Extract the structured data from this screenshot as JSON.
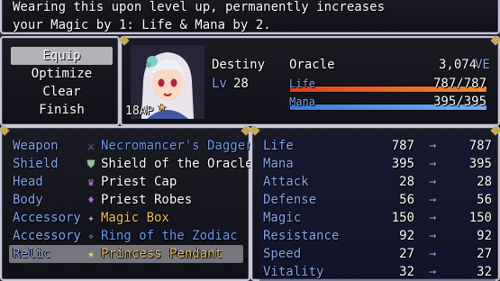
{
  "help": {
    "line1": "Wearing this upon level up, permanently increases",
    "line2": "your Magic by 1: Life & Mana by 2."
  },
  "commands": [
    "Equip",
    "Optimize",
    "Clear",
    "Finish"
  ],
  "actor": {
    "name": "Destiny",
    "class": "Oracle",
    "level_label": "Lv",
    "level": "28",
    "ap_badge": "18AP",
    "currency": "3,074",
    "currency_unit": "VE",
    "life_label": "Life",
    "life_value": "787/787",
    "life_ratio": 1.0,
    "mana_label": "Mana",
    "mana_value": "395/395",
    "mana_ratio": 1.0
  },
  "colors": {
    "system": "#84a8f0",
    "life_bar_start": "#e0401c",
    "life_bar_end": "#f08a30",
    "mana_bar_start": "#3a7ad8",
    "mana_bar_end": "#6fb2f2",
    "gold_item": "#f2c060",
    "blue_item": "#6c9cf2"
  },
  "slots": [
    {
      "slot": "Weapon",
      "item": "Necromancer's Dagger",
      "icon": "dagger-icon",
      "glyph": "⚔",
      "icon_color": "#a880e0",
      "item_color": "#6c9cf2"
    },
    {
      "slot": "Shield",
      "item": "Shield of the Oracle",
      "icon": "shield-icon",
      "glyph": "⛊",
      "icon_color": "#8ac0a0",
      "item_color": "#ffffff"
    },
    {
      "slot": "Head",
      "item": "Priest Cap",
      "icon": "cap-icon",
      "glyph": "♛",
      "icon_color": "#c080e0",
      "item_color": "#ffffff"
    },
    {
      "slot": "Body",
      "item": "Priest Robes",
      "icon": "robe-icon",
      "glyph": "♦",
      "icon_color": "#b070d8",
      "item_color": "#ffffff"
    },
    {
      "slot": "Accessory",
      "item": "Magic Box",
      "icon": "box-icon",
      "glyph": "✦",
      "icon_color": "#d090f0",
      "item_color": "#f2c060"
    },
    {
      "slot": "Accessory",
      "item": "Ring of the Zodiac",
      "icon": "ring-icon",
      "glyph": "✧",
      "icon_color": "#90c0f0",
      "item_color": "#6c9cf2"
    },
    {
      "slot": "Relic",
      "item": "Princess Pendant",
      "icon": "pendant-icon",
      "glyph": "✷",
      "icon_color": "#f0d070",
      "item_color": "#f2c060"
    }
  ],
  "params": [
    {
      "name": "Life",
      "cur": "787",
      "new": "787"
    },
    {
      "name": "Mana",
      "cur": "395",
      "new": "395"
    },
    {
      "name": "Attack",
      "cur": "28",
      "new": "28"
    },
    {
      "name": "Defense",
      "cur": "56",
      "new": "56"
    },
    {
      "name": "Magic",
      "cur": "150",
      "new": "150"
    },
    {
      "name": "Resistance",
      "cur": "92",
      "new": "92"
    },
    {
      "name": "Speed",
      "cur": "27",
      "new": "27"
    },
    {
      "name": "Vitality",
      "cur": "32",
      "new": "32"
    }
  ],
  "arrow": "→"
}
